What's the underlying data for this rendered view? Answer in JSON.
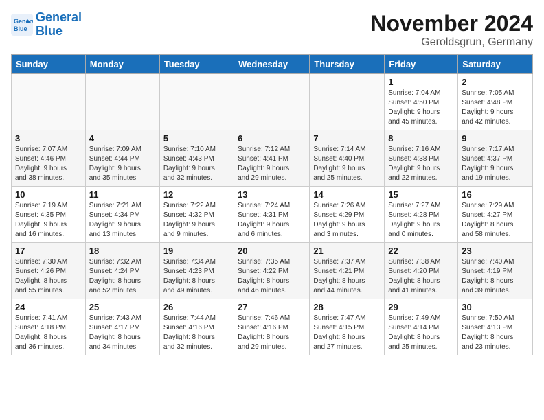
{
  "header": {
    "logo_line1": "General",
    "logo_line2": "Blue",
    "month_year": "November 2024",
    "location": "Geroldsgrun, Germany"
  },
  "days_of_week": [
    "Sunday",
    "Monday",
    "Tuesday",
    "Wednesday",
    "Thursday",
    "Friday",
    "Saturday"
  ],
  "weeks": [
    [
      {
        "day": "",
        "info": ""
      },
      {
        "day": "",
        "info": ""
      },
      {
        "day": "",
        "info": ""
      },
      {
        "day": "",
        "info": ""
      },
      {
        "day": "",
        "info": ""
      },
      {
        "day": "1",
        "info": "Sunrise: 7:04 AM\nSunset: 4:50 PM\nDaylight: 9 hours\nand 45 minutes."
      },
      {
        "day": "2",
        "info": "Sunrise: 7:05 AM\nSunset: 4:48 PM\nDaylight: 9 hours\nand 42 minutes."
      }
    ],
    [
      {
        "day": "3",
        "info": "Sunrise: 7:07 AM\nSunset: 4:46 PM\nDaylight: 9 hours\nand 38 minutes."
      },
      {
        "day": "4",
        "info": "Sunrise: 7:09 AM\nSunset: 4:44 PM\nDaylight: 9 hours\nand 35 minutes."
      },
      {
        "day": "5",
        "info": "Sunrise: 7:10 AM\nSunset: 4:43 PM\nDaylight: 9 hours\nand 32 minutes."
      },
      {
        "day": "6",
        "info": "Sunrise: 7:12 AM\nSunset: 4:41 PM\nDaylight: 9 hours\nand 29 minutes."
      },
      {
        "day": "7",
        "info": "Sunrise: 7:14 AM\nSunset: 4:40 PM\nDaylight: 9 hours\nand 25 minutes."
      },
      {
        "day": "8",
        "info": "Sunrise: 7:16 AM\nSunset: 4:38 PM\nDaylight: 9 hours\nand 22 minutes."
      },
      {
        "day": "9",
        "info": "Sunrise: 7:17 AM\nSunset: 4:37 PM\nDaylight: 9 hours\nand 19 minutes."
      }
    ],
    [
      {
        "day": "10",
        "info": "Sunrise: 7:19 AM\nSunset: 4:35 PM\nDaylight: 9 hours\nand 16 minutes."
      },
      {
        "day": "11",
        "info": "Sunrise: 7:21 AM\nSunset: 4:34 PM\nDaylight: 9 hours\nand 13 minutes."
      },
      {
        "day": "12",
        "info": "Sunrise: 7:22 AM\nSunset: 4:32 PM\nDaylight: 9 hours\nand 9 minutes."
      },
      {
        "day": "13",
        "info": "Sunrise: 7:24 AM\nSunset: 4:31 PM\nDaylight: 9 hours\nand 6 minutes."
      },
      {
        "day": "14",
        "info": "Sunrise: 7:26 AM\nSunset: 4:29 PM\nDaylight: 9 hours\nand 3 minutes."
      },
      {
        "day": "15",
        "info": "Sunrise: 7:27 AM\nSunset: 4:28 PM\nDaylight: 9 hours\nand 0 minutes."
      },
      {
        "day": "16",
        "info": "Sunrise: 7:29 AM\nSunset: 4:27 PM\nDaylight: 8 hours\nand 58 minutes."
      }
    ],
    [
      {
        "day": "17",
        "info": "Sunrise: 7:30 AM\nSunset: 4:26 PM\nDaylight: 8 hours\nand 55 minutes."
      },
      {
        "day": "18",
        "info": "Sunrise: 7:32 AM\nSunset: 4:24 PM\nDaylight: 8 hours\nand 52 minutes."
      },
      {
        "day": "19",
        "info": "Sunrise: 7:34 AM\nSunset: 4:23 PM\nDaylight: 8 hours\nand 49 minutes."
      },
      {
        "day": "20",
        "info": "Sunrise: 7:35 AM\nSunset: 4:22 PM\nDaylight: 8 hours\nand 46 minutes."
      },
      {
        "day": "21",
        "info": "Sunrise: 7:37 AM\nSunset: 4:21 PM\nDaylight: 8 hours\nand 44 minutes."
      },
      {
        "day": "22",
        "info": "Sunrise: 7:38 AM\nSunset: 4:20 PM\nDaylight: 8 hours\nand 41 minutes."
      },
      {
        "day": "23",
        "info": "Sunrise: 7:40 AM\nSunset: 4:19 PM\nDaylight: 8 hours\nand 39 minutes."
      }
    ],
    [
      {
        "day": "24",
        "info": "Sunrise: 7:41 AM\nSunset: 4:18 PM\nDaylight: 8 hours\nand 36 minutes."
      },
      {
        "day": "25",
        "info": "Sunrise: 7:43 AM\nSunset: 4:17 PM\nDaylight: 8 hours\nand 34 minutes."
      },
      {
        "day": "26",
        "info": "Sunrise: 7:44 AM\nSunset: 4:16 PM\nDaylight: 8 hours\nand 32 minutes."
      },
      {
        "day": "27",
        "info": "Sunrise: 7:46 AM\nSunset: 4:16 PM\nDaylight: 8 hours\nand 29 minutes."
      },
      {
        "day": "28",
        "info": "Sunrise: 7:47 AM\nSunset: 4:15 PM\nDaylight: 8 hours\nand 27 minutes."
      },
      {
        "day": "29",
        "info": "Sunrise: 7:49 AM\nSunset: 4:14 PM\nDaylight: 8 hours\nand 25 minutes."
      },
      {
        "day": "30",
        "info": "Sunrise: 7:50 AM\nSunset: 4:13 PM\nDaylight: 8 hours\nand 23 minutes."
      }
    ]
  ]
}
